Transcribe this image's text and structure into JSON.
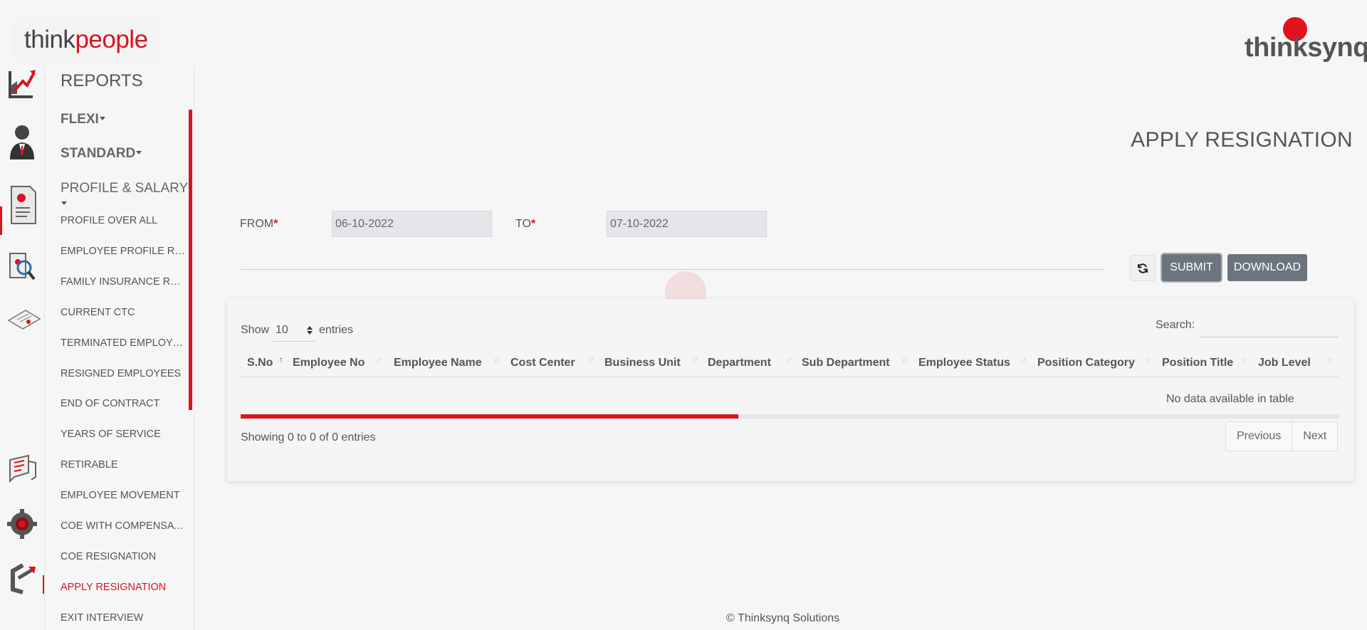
{
  "brand": {
    "left_logo_part1": "think",
    "left_logo_part2": "people",
    "right_logo": "thinksynq"
  },
  "sidebar": {
    "title": "REPORTS",
    "groups": [
      {
        "label": "FLEXI"
      },
      {
        "label": "STANDARD"
      },
      {
        "label": "PROFILE & SALARY"
      }
    ],
    "items": [
      {
        "label": "PROFILE OVER ALL"
      },
      {
        "label": "EMPLOYEE PROFILE REPORT"
      },
      {
        "label": "FAMILY INSURANCE REPORT"
      },
      {
        "label": "CURRENT CTC"
      },
      {
        "label": "TERMINATED EMPLOYEES"
      },
      {
        "label": "RESIGNED EMPLOYEES"
      },
      {
        "label": "END OF CONTRACT"
      },
      {
        "label": "YEARS OF SERVICE"
      },
      {
        "label": "RETIRABLE"
      },
      {
        "label": "EMPLOYEE MOVEMENT"
      },
      {
        "label": "COE WITH COMPENSATION"
      },
      {
        "label": "COE RESIGNATION"
      },
      {
        "label": "APPLY RESIGNATION"
      },
      {
        "label": "EXIT INTERVIEW"
      }
    ],
    "active_item": "APPLY RESIGNATION"
  },
  "rail": {
    "icons": [
      "reports-chart-icon",
      "employee-icon",
      "document-profile-icon",
      "search-employee-icon",
      "certificate-icon",
      "messages-icon",
      "settings-gear-icon",
      "logout-icon"
    ]
  },
  "page": {
    "title": "APPLY RESIGNATION",
    "from_label": "FROM",
    "to_label": "TO",
    "required_mark": "*",
    "from_value": "06-10-2022",
    "to_value": "07-10-2022",
    "submit_label": "SUBMIT",
    "download_label": "DOWNLOAD"
  },
  "table": {
    "show_label": "Show",
    "entries_label": "entries",
    "length_value": "10",
    "search_label": "Search:",
    "search_value": "",
    "columns": [
      "S.No",
      "Employee No",
      "Employee Name",
      "Cost Center",
      "Business Unit",
      "Department",
      "Sub Department",
      "Employee Status",
      "Position Category",
      "Position Title",
      "Job Level"
    ],
    "empty_message": "No data available in table",
    "info": "Showing 0 to 0 of 0 entries",
    "previous_label": "Previous",
    "next_label": "Next",
    "loading_progress": 0.453
  },
  "footer": {
    "text": "© Thinksynq Solutions"
  },
  "colors": {
    "accent": "#d8141f",
    "button": "#6c757d",
    "background": "#f6f6f6"
  }
}
